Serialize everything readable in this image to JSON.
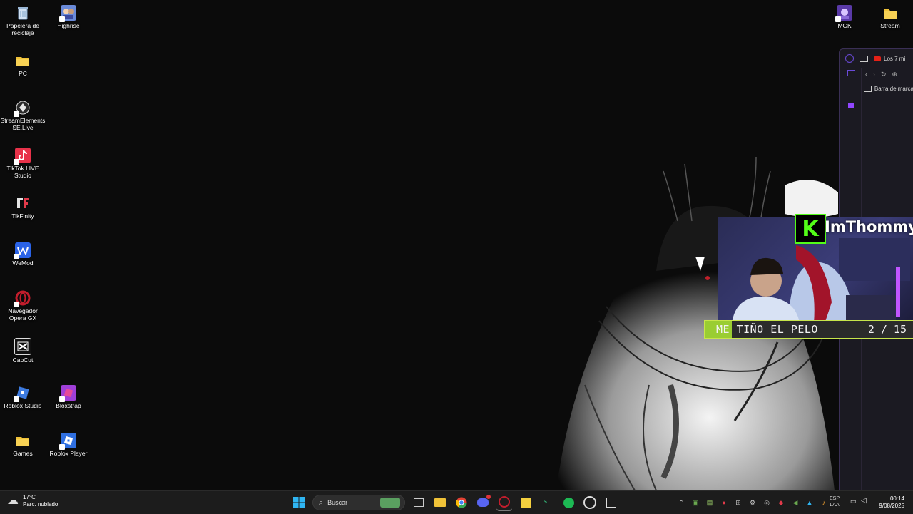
{
  "desktop": {
    "icons": [
      {
        "id": "recycle",
        "label": "Papelera de reciclaje",
        "icon": "recycle-bin-icon",
        "color": "#9ab7d6"
      },
      {
        "id": "highrise",
        "label": "Highrise",
        "icon": "highrise-icon",
        "color": "#6a8ad8"
      },
      {
        "id": "pc",
        "label": "PC",
        "icon": "folder-icon",
        "color": "#f0c238"
      },
      {
        "id": "streamelements",
        "label": "StreamElements SE.Live",
        "icon": "streamelements-icon",
        "color": "#3a3a3a"
      },
      {
        "id": "tiktok",
        "label": "TikTok LIVE Studio",
        "icon": "tiktok-live-icon",
        "color": "#e8324a"
      },
      {
        "id": "tikfinity",
        "label": "TikFinity",
        "icon": "tikfinity-icon",
        "color": "#111111"
      },
      {
        "id": "wemod",
        "label": "WeMod",
        "icon": "wemod-icon",
        "color": "#2a63e8"
      },
      {
        "id": "operagx",
        "label": "Navegador Opera GX",
        "icon": "opera-gx-icon",
        "color": "#c21d2c"
      },
      {
        "id": "capcut",
        "label": "CapCut",
        "icon": "capcut-icon",
        "color": "#eeeeee"
      },
      {
        "id": "robloxstudio",
        "label": "Roblox Studio",
        "icon": "roblox-studio-icon",
        "color": "#3d7be0"
      },
      {
        "id": "bloxstrap",
        "label": "Bloxstrap",
        "icon": "bloxstrap-icon",
        "color": "#a03fd8"
      },
      {
        "id": "games",
        "label": "Games",
        "icon": "folder-icon",
        "color": "#f0c238"
      },
      {
        "id": "robloxplayer",
        "label": "Roblox Player",
        "icon": "roblox-player-icon",
        "color": "#2f6fe0"
      },
      {
        "id": "mgk",
        "label": "MGK",
        "icon": "mgk-icon",
        "color": "#5a3aa8"
      },
      {
        "id": "stream",
        "label": "Stream",
        "icon": "folder-icon",
        "color": "#f0c238"
      }
    ]
  },
  "browser": {
    "tab_title": "Los 7 mi",
    "bookmarks_label": "Barra de marca"
  },
  "overlay": {
    "badge_letter": "K",
    "username": "ImThommy",
    "goal_label": "ME TIÑO EL PELO",
    "goal_current": "2",
    "goal_total": "15",
    "goal_count_text": "2 / 15",
    "goal_fraction": 0.13,
    "accent": "#53fc18"
  },
  "taskbar": {
    "weather_temp": "17°C",
    "weather_desc": "Parc. nublado",
    "search_placeholder": "Buscar",
    "lang_top": "ESP",
    "lang_bottom": "LAA",
    "time": "00:14",
    "date": "9/08/2025"
  }
}
